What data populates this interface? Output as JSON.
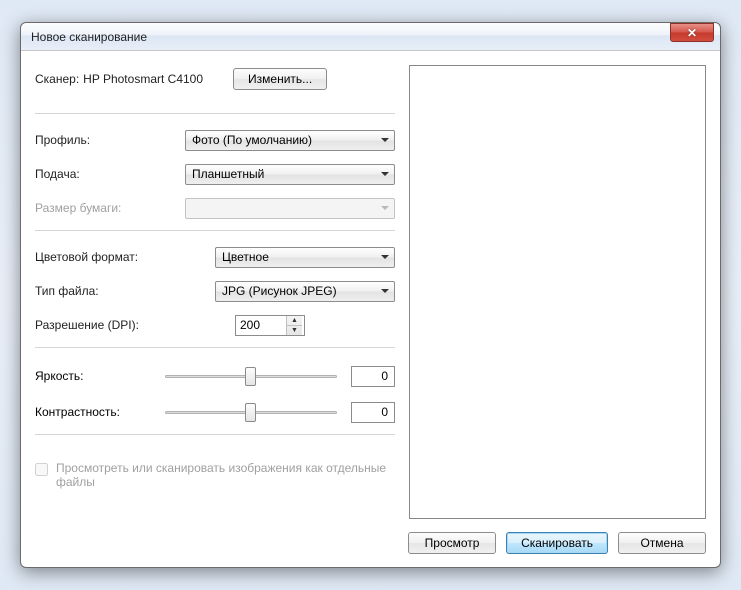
{
  "window": {
    "title": "Новое сканирование"
  },
  "scanner": {
    "label": "Сканер:",
    "name": "HP Photosmart C4100",
    "change_label": "Изменить..."
  },
  "fields": {
    "profile_label": "Профиль:",
    "profile_value": "Фото (По умолчанию)",
    "source_label": "Подача:",
    "source_value": "Планшетный",
    "paper_label": "Размер бумаги:",
    "paper_value": "",
    "color_label": "Цветовой формат:",
    "color_value": "Цветное",
    "filetype_label": "Тип файла:",
    "filetype_value": "JPG (Рисунок JPEG)",
    "dpi_label": "Разрешение (DPI):",
    "dpi_value": "200",
    "brightness_label": "Яркость:",
    "brightness_value": "0",
    "contrast_label": "Контрастность:",
    "contrast_value": "0"
  },
  "checkbox": {
    "label": "Просмотреть или сканировать изображения как отдельные файлы"
  },
  "buttons": {
    "preview": "Просмотр",
    "scan": "Сканировать",
    "cancel": "Отмена"
  }
}
